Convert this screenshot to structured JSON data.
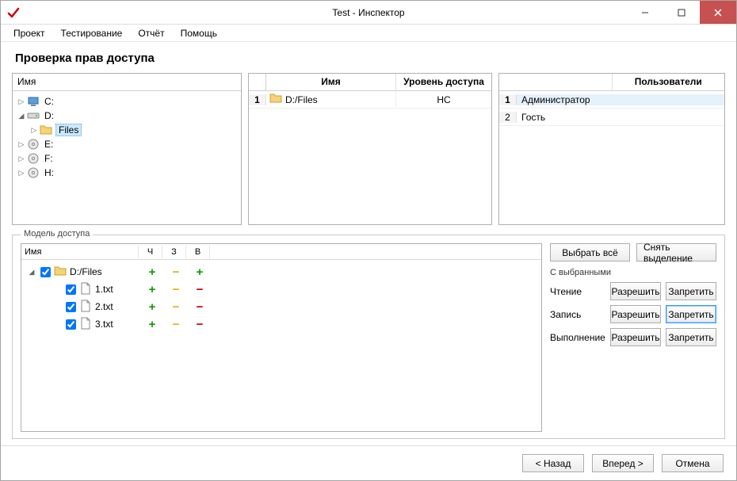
{
  "window": {
    "title": "Test - Инспектор"
  },
  "menubar": {
    "items": [
      "Проект",
      "Тестирование",
      "Отчёт",
      "Помощь"
    ]
  },
  "page": {
    "title": "Проверка прав доступа"
  },
  "drives_panel": {
    "header": "Имя",
    "tree": [
      {
        "label": "C:",
        "icon": "computer",
        "depth": 0,
        "toggle": "▷",
        "selected": false
      },
      {
        "label": "D:",
        "icon": "drive",
        "depth": 0,
        "toggle": "◢",
        "selected": false
      },
      {
        "label": "Files",
        "icon": "folder",
        "depth": 1,
        "toggle": "▷",
        "selected": true
      },
      {
        "label": "E:",
        "icon": "disc",
        "depth": 0,
        "toggle": "▷",
        "selected": false
      },
      {
        "label": "F:",
        "icon": "disc",
        "depth": 0,
        "toggle": "▷",
        "selected": false
      },
      {
        "label": "H:",
        "icon": "disc",
        "depth": 0,
        "toggle": "▷",
        "selected": false
      }
    ]
  },
  "access_panel": {
    "headers": {
      "name": "Имя",
      "level": "Уровень доступа"
    },
    "rows": [
      {
        "num": "1",
        "icon": "folder",
        "name": "D:/Files",
        "level": "НС"
      }
    ]
  },
  "users_panel": {
    "header": "Пользователи",
    "rows": [
      {
        "num": "1",
        "name": "Администратор",
        "selected": true
      },
      {
        "num": "2",
        "name": "Гость",
        "selected": false
      }
    ]
  },
  "model_group": {
    "title": "Модель доступа",
    "headers": {
      "name": "Имя",
      "read": "Ч",
      "write": "З",
      "exec": "В"
    },
    "rows": [
      {
        "depth": 0,
        "toggle": "◢",
        "checked": true,
        "icon": "folder",
        "name": "D:/Files",
        "read": "+",
        "write": "~",
        "exec": "+"
      },
      {
        "depth": 1,
        "toggle": "",
        "checked": true,
        "icon": "file",
        "name": "1.txt",
        "read": "+",
        "write": "~",
        "exec": "−"
      },
      {
        "depth": 1,
        "toggle": "",
        "checked": true,
        "icon": "file",
        "name": "2.txt",
        "read": "+",
        "write": "~",
        "exec": "−"
      },
      {
        "depth": 1,
        "toggle": "",
        "checked": true,
        "icon": "file",
        "name": "3.txt",
        "read": "+",
        "write": "~",
        "exec": "−"
      }
    ],
    "side": {
      "select_all": "Выбрать всё",
      "deselect": "Снять выделение",
      "with_selected": "С выбранными",
      "perms": [
        {
          "label": "Чтение",
          "allow": "Разрешить",
          "deny": "Запретить",
          "deny_focus": false
        },
        {
          "label": "Запись",
          "allow": "Разрешить",
          "deny": "Запретить",
          "deny_focus": true
        },
        {
          "label": "Выполнение",
          "allow": "Разрешить",
          "deny": "Запретить",
          "deny_focus": false
        }
      ]
    }
  },
  "wizard": {
    "back": "< Назад",
    "next": "Вперед >",
    "cancel": "Отмена"
  }
}
